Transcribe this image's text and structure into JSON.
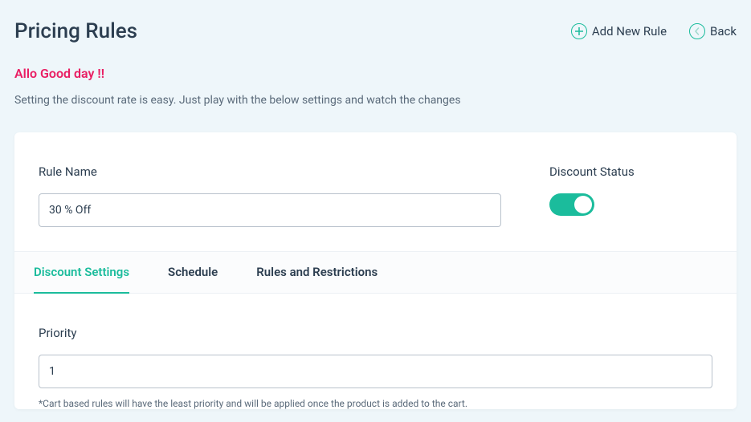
{
  "header": {
    "title": "Pricing Rules",
    "add_label": "Add New Rule",
    "back_label": "Back"
  },
  "greeting": "Allo Good day !!",
  "instruction": "Setting the discount rate is easy. Just play with the below settings and watch the changes",
  "rule": {
    "name_label": "Rule Name",
    "name_value": "30 % Off",
    "status_label": "Discount Status",
    "status_on": true
  },
  "tabs": [
    {
      "label": "Discount Settings",
      "active": true
    },
    {
      "label": "Schedule",
      "active": false
    },
    {
      "label": "Rules and Restrictions",
      "active": false
    }
  ],
  "priority": {
    "label": "Priority",
    "value": "1",
    "hint": "*Cart based rules will have the least priority and will be applied once the product is added to the cart."
  },
  "colors": {
    "accent": "#1bbc9c",
    "danger": "#e91e63"
  }
}
